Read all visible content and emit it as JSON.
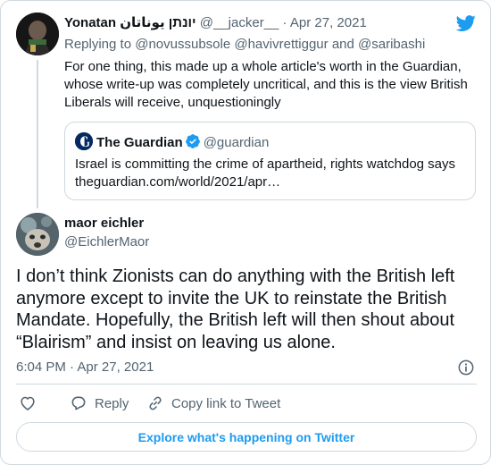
{
  "reply_tweet": {
    "author_name": "Yonatan יונתן يوناتان",
    "handle": "@__jacker__",
    "separator": "·",
    "date": "Apr 27, 2021",
    "replying_to_label": "Replying to",
    "replying_to": [
      "@novussubsole",
      "@havivrettiggur",
      "@saribashi"
    ],
    "replying_and": "and",
    "text": "For one thing, this made up a whole article's worth in the Guardian, whose write-up was completely uncritical, and this is the view British Liberals will receive, unquestioningly",
    "quote": {
      "name": "The Guardian",
      "handle": "@guardian",
      "text_line1": "Israel is committing the crime of apartheid, rights watchdog says",
      "text_line2": "theguardian.com/world/2021/apr…"
    }
  },
  "main_tweet": {
    "author_name": "maor eichler",
    "handle": "@EichlerMaor",
    "text": "I don’t think Zionists can do anything with the British left anymore except to invite the UK to reinstate the British Mandate. Hopefully, the British left will then shout about “Blairism” and insist on leaving us alone.",
    "time": "6:04 PM",
    "separator": "·",
    "date": "Apr 27, 2021"
  },
  "actions": {
    "reply_label": "Reply",
    "copy_label": "Copy link to Tweet"
  },
  "explore_label": "Explore what's happening on Twitter",
  "colors": {
    "accent": "#1d9bf0",
    "text": "#0f1419",
    "muted": "#536471",
    "border": "#cfd9de",
    "verified": "#1d9bf0",
    "guardian": "#052962"
  },
  "icons": [
    "twitter-bird-icon",
    "verified-badge-icon",
    "info-icon",
    "heart-icon",
    "reply-icon",
    "link-icon"
  ]
}
